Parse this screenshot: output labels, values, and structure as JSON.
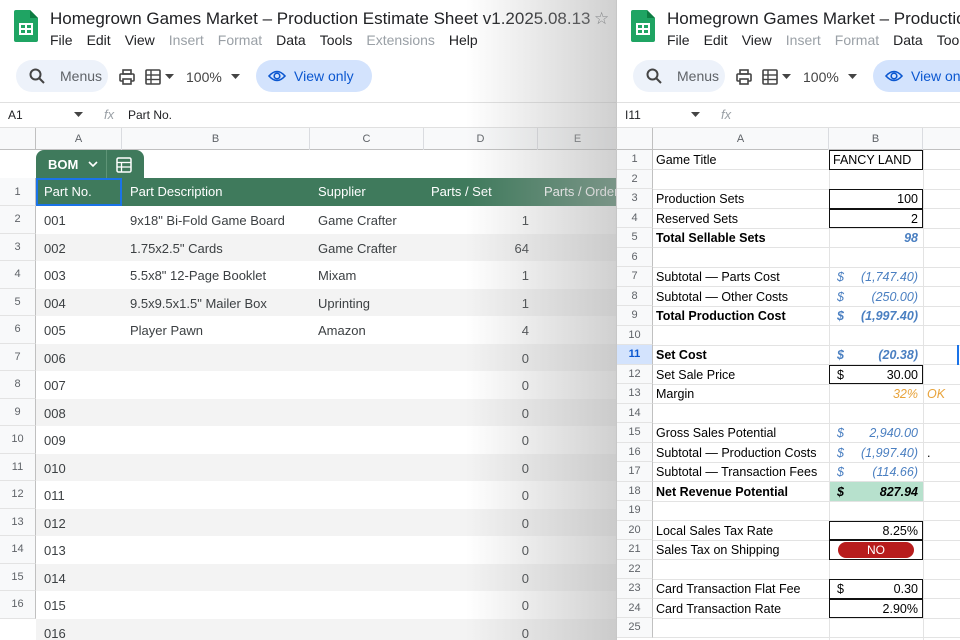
{
  "left": {
    "title": "Homegrown Games Market – Production Estimate Sheet v1.2025.08.13",
    "menus": [
      "File",
      "Edit",
      "View",
      "Insert",
      "Format",
      "Data",
      "Tools",
      "Extensions",
      "Help"
    ],
    "menus_dim": [
      false,
      false,
      false,
      true,
      true,
      false,
      false,
      true,
      false
    ],
    "search_label": "Menus",
    "zoom": "100%",
    "view_only": "View only",
    "namebox": "A1",
    "formula": "Part No.",
    "columns": [
      "A",
      "B",
      "C",
      "D",
      "E"
    ],
    "rows": [
      "1",
      "2",
      "3",
      "4",
      "5",
      "6",
      "7",
      "8",
      "9",
      "10",
      "11",
      "12",
      "13",
      "14",
      "15",
      "16"
    ],
    "table_name": "BOM",
    "headers": [
      "Part No.",
      "Part Description",
      "Supplier",
      "Parts / Set",
      "Parts / Order"
    ],
    "items": [
      {
        "part": "001",
        "desc": "9x18\" Bi-Fold Game Board",
        "supplier": "Game Crafter",
        "qty": "1"
      },
      {
        "part": "002",
        "desc": "1.75x2.5\" Cards",
        "supplier": "Game Crafter",
        "qty": "64"
      },
      {
        "part": "003",
        "desc": "5.5x8\" 12-Page Booklet",
        "supplier": "Mixam",
        "qty": "1"
      },
      {
        "part": "004",
        "desc": "9.5x9.5x1.5\" Mailer Box",
        "supplier": "Uprinting",
        "qty": "1"
      },
      {
        "part": "005",
        "desc": "Player Pawn",
        "supplier": "Amazon",
        "qty": "4"
      },
      {
        "part": "006",
        "desc": "",
        "supplier": "",
        "qty": "0"
      },
      {
        "part": "007",
        "desc": "",
        "supplier": "",
        "qty": "0"
      },
      {
        "part": "008",
        "desc": "",
        "supplier": "",
        "qty": "0"
      },
      {
        "part": "009",
        "desc": "",
        "supplier": "",
        "qty": "0"
      },
      {
        "part": "010",
        "desc": "",
        "supplier": "",
        "qty": "0"
      },
      {
        "part": "011",
        "desc": "",
        "supplier": "",
        "qty": "0"
      },
      {
        "part": "012",
        "desc": "",
        "supplier": "",
        "qty": "0"
      },
      {
        "part": "013",
        "desc": "",
        "supplier": "",
        "qty": "0"
      },
      {
        "part": "014",
        "desc": "",
        "supplier": "",
        "qty": "0"
      },
      {
        "part": "015",
        "desc": "",
        "supplier": "",
        "qty": "0"
      },
      {
        "part": "016",
        "desc": "",
        "supplier": "",
        "qty": "0"
      }
    ]
  },
  "right": {
    "title": "Homegrown Games Market – Productio",
    "menus": [
      "File",
      "Edit",
      "View",
      "Insert",
      "Format",
      "Data",
      "Tools"
    ],
    "menus_dim": [
      false,
      false,
      false,
      true,
      true,
      false,
      false
    ],
    "search_label": "Menus",
    "zoom": "100%",
    "view_only": "View onl",
    "namebox": "I11",
    "columns": [
      "A",
      "B"
    ],
    "rows": [
      "1",
      "2",
      "3",
      "4",
      "5",
      "6",
      "7",
      "8",
      "9",
      "10",
      "11",
      "12",
      "13",
      "14",
      "15",
      "16",
      "17",
      "18",
      "19",
      "20",
      "21",
      "22",
      "23",
      "24",
      "25"
    ],
    "cells": [
      {
        "row": 1,
        "label": "Game Title",
        "value": "FANCY LAND",
        "style": "box-left"
      },
      {
        "row": 3,
        "label": "Production Sets",
        "value": "100",
        "style": "box-right"
      },
      {
        "row": 4,
        "label": "Reserved Sets",
        "value": "2",
        "style": "box-right"
      },
      {
        "row": 5,
        "label": "Total Sellable Sets",
        "value": "98",
        "style": "blue-bold",
        "bold": true
      },
      {
        "row": 7,
        "label": "Subtotal — Parts Cost",
        "currency": "$",
        "value": "(1,747.40)",
        "style": "blue"
      },
      {
        "row": 8,
        "label": "Subtotal — Other Costs",
        "currency": "$",
        "value": "(250.00)",
        "style": "blue"
      },
      {
        "row": 9,
        "label": "Total Production Cost",
        "currency": "$",
        "value": "(1,997.40)",
        "style": "blue-bold",
        "bold": true
      },
      {
        "row": 11,
        "label": "Set Cost",
        "currency": "$",
        "value": "(20.38)",
        "style": "blue-bold",
        "bold": true
      },
      {
        "row": 12,
        "label": "Set Sale Price",
        "currency": "$",
        "value": "30.00",
        "style": "box-currency"
      },
      {
        "row": 13,
        "label": "Margin",
        "value": "32%",
        "note": "OK",
        "style": "orange"
      },
      {
        "row": 15,
        "label": "Gross Sales Potential",
        "currency": "$",
        "value": "2,940.00",
        "style": "blue"
      },
      {
        "row": 16,
        "label": "Subtotal — Production Costs",
        "currency": "$",
        "value": "(1,997.40)",
        "note": ".",
        "style": "blue"
      },
      {
        "row": 17,
        "label": "Subtotal — Transaction Fees",
        "currency": "$",
        "value": "(114.66)",
        "style": "blue"
      },
      {
        "row": 18,
        "label": "Net Revenue Potential",
        "currency": "$",
        "value": "827.94",
        "style": "green-bold",
        "bold": true
      },
      {
        "row": 20,
        "label": "Local Sales Tax Rate",
        "value": "8.25%",
        "style": "box-right"
      },
      {
        "row": 21,
        "label": "Sales Tax on Shipping",
        "value": "NO",
        "style": "pill"
      },
      {
        "row": 23,
        "label": "Card Transaction Flat Fee",
        "currency": "$",
        "value": "0.30",
        "style": "box-currency"
      },
      {
        "row": 24,
        "label": "Card Transaction Rate",
        "value": "2.90%",
        "style": "box-right"
      }
    ]
  },
  "colors": {
    "table_header": "#3f7a5c",
    "accent_blue": "#1a73e8",
    "value_blue": "#4a7fc1",
    "orange": "#e8a33b",
    "green_fill": "#b7e1cd",
    "no_red": "#b71c1c"
  }
}
